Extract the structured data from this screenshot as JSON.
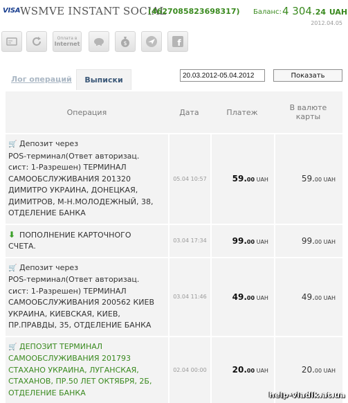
{
  "header": {
    "visa_logo": "VISA",
    "card_title": "WSMVE INSTANT SOCIAL",
    "card_number": "(4627085823698317)",
    "balance_label": "Баланс:",
    "balance_int": "4 304.",
    "balance_dec": "24",
    "balance_currency": "UAH",
    "date": "2012.04.05"
  },
  "toolbar": {
    "buttons": [
      {
        "icon": "card-icon"
      },
      {
        "icon": "refresh-icon"
      },
      {
        "icon": "internet-pay-icon",
        "line1": "Оплата в",
        "line2": "Internet"
      },
      {
        "icon": "piggy-bank-icon"
      },
      {
        "icon": "money-bag-icon"
      },
      {
        "icon": "airplane-icon"
      },
      {
        "icon": "facebook-icon"
      }
    ]
  },
  "tabs": {
    "log": "Лог операций",
    "statements": "Выписки"
  },
  "filter": {
    "date_range": "20.03.2012-05.04.2012",
    "show_button": "Показать"
  },
  "table": {
    "headers": {
      "operation": "Операция",
      "date": "Дата",
      "payment": "Платеж",
      "in_currency_line1": "В валюте",
      "in_currency_line2": "карты"
    },
    "rows": [
      {
        "icon": "cart-icon",
        "lines": [
          "Депозит через",
          "POS-терминал(Ответ авторизац.",
          "сист: 1-Разрешен) ТЕРМИНАЛ",
          "САМООБСЛУЖИВАНИЯ 201320",
          "ДИМИТРО УКРАИНА, ДОНЕЦКАЯ,",
          "ДИМИТРОВ, М-Н.МОЛОДЕЖНЫЙ, 38,",
          "ОТДЕЛЕНИЕ БАНКА"
        ],
        "date": "05.04 10:57",
        "pay_int": "59.",
        "pay_dec": "00",
        "pay_unit": "UAH",
        "cur_int": "59.",
        "cur_dec": "00",
        "cur_unit": "UAH",
        "green": false
      },
      {
        "icon": "arrow-down-icon",
        "lines": [
          "ПОПОЛНЕНИЕ КАРТОЧНОГО",
          "СЧЕТА."
        ],
        "date": "03.04 17:34",
        "pay_int": "99.",
        "pay_dec": "00",
        "pay_unit": "UAH",
        "cur_int": "99.",
        "cur_dec": "00",
        "cur_unit": "UAH",
        "green": false
      },
      {
        "icon": "cart-icon",
        "lines": [
          "Депозит через",
          "POS-терминал(Ответ авторизац.",
          "сист: 1-Разрешен) ТЕРМИНАЛ",
          "САМООБСЛУЖИВАНИЯ 200562 КИЕВ",
          "УКРАИНА, КИЕВСКАЯ, КИЕВ,",
          "ПР.ПРАВДЫ, 35, ОТДЕЛЕНИЕ БАНКА"
        ],
        "date": "03.04 11:46",
        "pay_int": "49.",
        "pay_dec": "00",
        "pay_unit": "UAH",
        "cur_int": "49.",
        "cur_dec": "00",
        "cur_unit": "UAH",
        "green": false
      },
      {
        "icon": "cart-icon",
        "lines": [
          "ДЕПОЗИТ ТЕРМИНАЛ",
          "САМООБСЛУЖИВАНИЯ 201793",
          "СТАХАНО УКРАИНА, ЛУГАНСКАЯ,",
          "СТАХАНОВ, ПР.50 ЛЕТ ОКТЯБРЯ, 2Б,",
          "ОТДЕЛЕНИЕ БАНКА"
        ],
        "date": "02.04 00:00",
        "pay_int": "20.",
        "pay_dec": "00",
        "pay_unit": "UAH",
        "cur_int": "20.",
        "cur_dec": "00",
        "cur_unit": "UAH",
        "green": true
      }
    ]
  },
  "watermark": "help-vladik.at.ua"
}
